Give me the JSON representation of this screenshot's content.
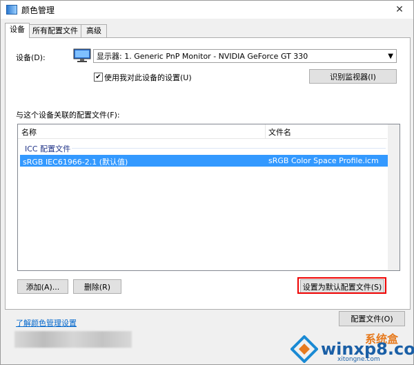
{
  "window": {
    "title": "颜色管理",
    "close": "✕"
  },
  "tabs": [
    "设备",
    "所有配置文件",
    "高级"
  ],
  "device": {
    "label": "设备(D):",
    "selected": "显示器: 1. Generic PnP Monitor - NVIDIA GeForce GT 330",
    "use_settings_label": "使用我对此设备的设置(U)",
    "use_settings_checked": true,
    "identify_button": "识别监视器(I)"
  },
  "profiles": {
    "label": "与这个设备关联的配置文件(F):",
    "columns": [
      "名称",
      "文件名"
    ],
    "group": "ICC 配置文件",
    "rows": [
      {
        "name": "sRGB IEC61966-2.1 (默认值)",
        "file": "sRGB Color Space Profile.icm"
      }
    ]
  },
  "buttons": {
    "add": "添加(A)...",
    "remove": "删除(R)",
    "set_default": "设置为默认配置文件(S)",
    "profiles": "配置文件(O)"
  },
  "footer": {
    "link": "了解颜色管理设置"
  },
  "watermark": {
    "main": "winxp8.com",
    "sub": "xitongne.com",
    "top": "系统盒"
  }
}
